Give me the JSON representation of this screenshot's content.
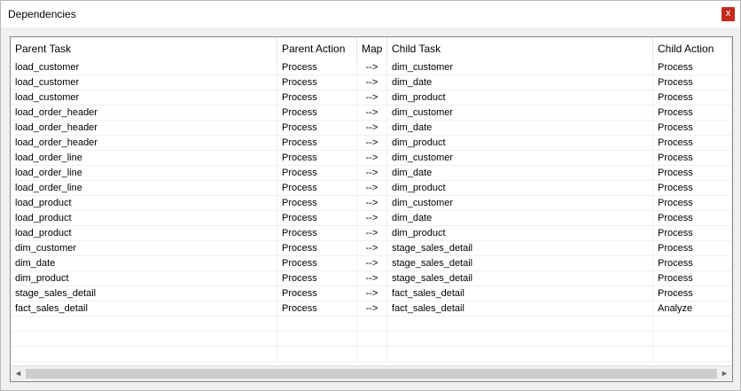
{
  "window": {
    "title": "Dependencies",
    "close_label": "x"
  },
  "columns": [
    "Parent Task",
    "Parent Action",
    "Map",
    "Child Task",
    "Child Action"
  ],
  "rows": [
    [
      "load_customer",
      "Process",
      "-->",
      "dim_customer",
      "Process"
    ],
    [
      "load_customer",
      "Process",
      "-->",
      "dim_date",
      "Process"
    ],
    [
      "load_customer",
      "Process",
      "-->",
      "dim_product",
      "Process"
    ],
    [
      "load_order_header",
      "Process",
      "-->",
      "dim_customer",
      "Process"
    ],
    [
      "load_order_header",
      "Process",
      "-->",
      "dim_date",
      "Process"
    ],
    [
      "load_order_header",
      "Process",
      "-->",
      "dim_product",
      "Process"
    ],
    [
      "load_order_line",
      "Process",
      "-->",
      "dim_customer",
      "Process"
    ],
    [
      "load_order_line",
      "Process",
      "-->",
      "dim_date",
      "Process"
    ],
    [
      "load_order_line",
      "Process",
      "-->",
      "dim_product",
      "Process"
    ],
    [
      "load_product",
      "Process",
      "-->",
      "dim_customer",
      "Process"
    ],
    [
      "load_product",
      "Process",
      "-->",
      "dim_date",
      "Process"
    ],
    [
      "load_product",
      "Process",
      "-->",
      "dim_product",
      "Process"
    ],
    [
      "dim_customer",
      "Process",
      "-->",
      "stage_sales_detail",
      "Process"
    ],
    [
      "dim_date",
      "Process",
      "-->",
      "stage_sales_detail",
      "Process"
    ],
    [
      "dim_product",
      "Process",
      "-->",
      "stage_sales_detail",
      "Process"
    ],
    [
      "stage_sales_detail",
      "Process",
      "-->",
      "fact_sales_detail",
      "Process"
    ],
    [
      "fact_sales_detail",
      "Process",
      "-->",
      "fact_sales_detail",
      "Analyze"
    ],
    [
      "",
      "",
      "",
      "",
      ""
    ],
    [
      "",
      "",
      "",
      "",
      ""
    ],
    [
      "",
      "",
      "",
      "",
      ""
    ]
  ],
  "scrollbar": {
    "left_arrow": "◄",
    "right_arrow": "►"
  }
}
